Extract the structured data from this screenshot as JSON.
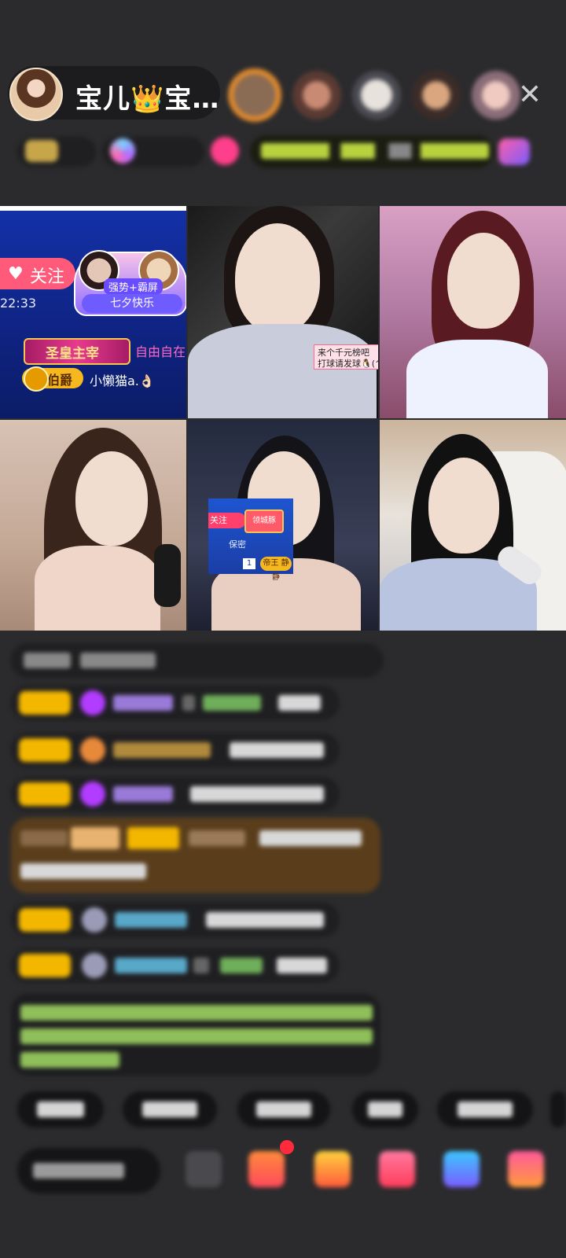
{
  "header": {
    "host_name": "宝儿👑宝…",
    "close_glyph": "✕"
  },
  "cells": {
    "c1": {
      "follow_label": "关注",
      "couple_tag": "强势+霸屏",
      "couple_caption": "七夕快乐",
      "time": "22:33",
      "rank_badge": "圣皇主宰",
      "rank_user": "自由自在",
      "noble_badge": "伯爵",
      "noble_user": "小懒猫a.👌🏻"
    },
    "c2": {
      "sticker_line1": "来个千元榜吧",
      "sticker_line2": "打球请发球🐧(^"
    },
    "c5": {
      "mini_follow": "关注",
      "mini_badge_top": "领城豚",
      "mini_row2": "保密",
      "mini_num": "1",
      "mini_badge": "帝王 静静"
    }
  },
  "colors": {
    "background": "#2b2b2d",
    "badge_gold": "#f3b700",
    "accent_pink": "#ff3f8b"
  }
}
